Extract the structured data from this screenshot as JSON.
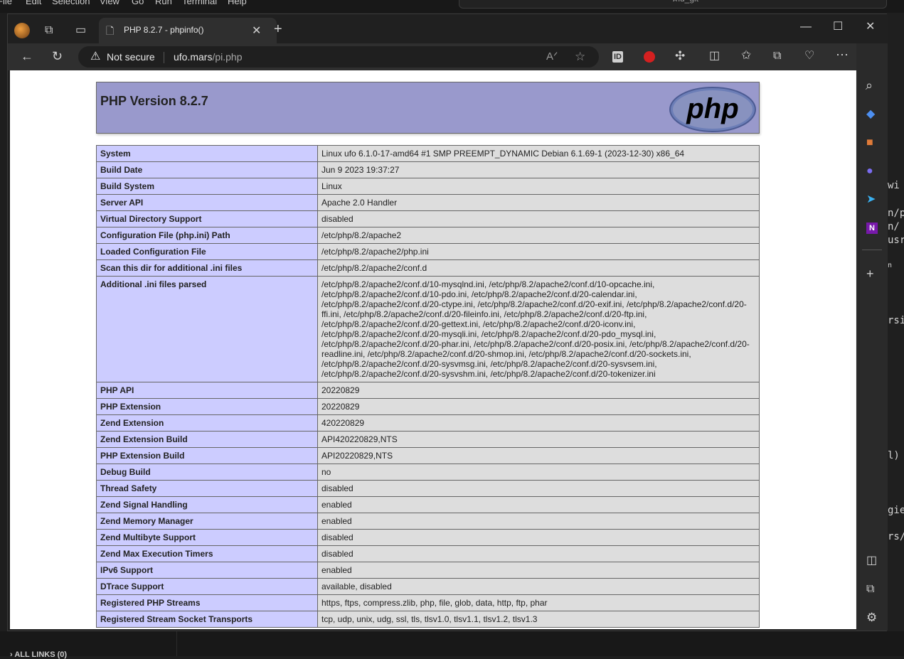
{
  "vscode": {
    "menu": [
      "File",
      "Edit",
      "Selection",
      "View",
      "Go",
      "Run",
      "Terminal",
      "Help"
    ],
    "search_text": "md_git",
    "code_fragments": [
      "wi",
      "n/p",
      "n/",
      "usr",
      "n",
      "rsi",
      "l)",
      "gie",
      "rs/"
    ],
    "sidebar_section": "ALL LINKS (0)"
  },
  "browser": {
    "tab_title": "PHP 8.2.7 - phpinfo()",
    "security_label": "Not secure",
    "url_host": "ufo.mars",
    "url_path": "/pi.php",
    "icons": {
      "profile": "profile-avatar-icon",
      "workspaces": "workspaces-icon",
      "tab_actions": "tab-actions-icon",
      "new_tab": "plus-icon",
      "back": "back-arrow-icon",
      "refresh": "refresh-icon",
      "read_aloud": "read-aloud-icon",
      "favorite": "star-icon",
      "extensions": "puzzle-icon",
      "split": "split-screen-icon",
      "favorites": "favorites-icon",
      "collections": "collections-icon",
      "performance": "heart-pulse-icon",
      "more": "more-icon",
      "copilot": "copilot-icon"
    }
  },
  "phpinfo": {
    "title": "PHP Version 8.2.7",
    "logo_text": "php",
    "rows": [
      {
        "k": "System",
        "v": "Linux ufo 6.1.0-17-amd64 #1 SMP PREEMPT_DYNAMIC Debian 6.1.69-1 (2023-12-30) x86_64"
      },
      {
        "k": "Build Date",
        "v": "Jun 9 2023 19:37:27"
      },
      {
        "k": "Build System",
        "v": "Linux"
      },
      {
        "k": "Server API",
        "v": "Apache 2.0 Handler"
      },
      {
        "k": "Virtual Directory Support",
        "v": "disabled"
      },
      {
        "k": "Configuration File (php.ini) Path",
        "v": "/etc/php/8.2/apache2"
      },
      {
        "k": "Loaded Configuration File",
        "v": "/etc/php/8.2/apache2/php.ini"
      },
      {
        "k": "Scan this dir for additional .ini files",
        "v": "/etc/php/8.2/apache2/conf.d"
      },
      {
        "k": "Additional .ini files parsed",
        "v": "/etc/php/8.2/apache2/conf.d/10-mysqlnd.ini, /etc/php/8.2/apache2/conf.d/10-opcache.ini, /etc/php/8.2/apache2/conf.d/10-pdo.ini, /etc/php/8.2/apache2/conf.d/20-calendar.ini, /etc/php/8.2/apache2/conf.d/20-ctype.ini, /etc/php/8.2/apache2/conf.d/20-exif.ini, /etc/php/8.2/apache2/conf.d/20-ffi.ini, /etc/php/8.2/apache2/conf.d/20-fileinfo.ini, /etc/php/8.2/apache2/conf.d/20-ftp.ini, /etc/php/8.2/apache2/conf.d/20-gettext.ini, /etc/php/8.2/apache2/conf.d/20-iconv.ini, /etc/php/8.2/apache2/conf.d/20-mysqli.ini, /etc/php/8.2/apache2/conf.d/20-pdo_mysql.ini, /etc/php/8.2/apache2/conf.d/20-phar.ini, /etc/php/8.2/apache2/conf.d/20-posix.ini, /etc/php/8.2/apache2/conf.d/20-readline.ini, /etc/php/8.2/apache2/conf.d/20-shmop.ini, /etc/php/8.2/apache2/conf.d/20-sockets.ini, /etc/php/8.2/apache2/conf.d/20-sysvmsg.ini, /etc/php/8.2/apache2/conf.d/20-sysvsem.ini, /etc/php/8.2/apache2/conf.d/20-sysvshm.ini, /etc/php/8.2/apache2/conf.d/20-tokenizer.ini"
      },
      {
        "k": "PHP API",
        "v": "20220829"
      },
      {
        "k": "PHP Extension",
        "v": "20220829"
      },
      {
        "k": "Zend Extension",
        "v": "420220829"
      },
      {
        "k": "Zend Extension Build",
        "v": "API420220829,NTS"
      },
      {
        "k": "PHP Extension Build",
        "v": "API20220829,NTS"
      },
      {
        "k": "Debug Build",
        "v": "no"
      },
      {
        "k": "Thread Safety",
        "v": "disabled"
      },
      {
        "k": "Zend Signal Handling",
        "v": "enabled"
      },
      {
        "k": "Zend Memory Manager",
        "v": "enabled"
      },
      {
        "k": "Zend Multibyte Support",
        "v": "disabled"
      },
      {
        "k": "Zend Max Execution Timers",
        "v": "disabled"
      },
      {
        "k": "IPv6 Support",
        "v": "enabled"
      },
      {
        "k": "DTrace Support",
        "v": "available, disabled"
      },
      {
        "k": "Registered PHP Streams",
        "v": "https, ftps, compress.zlib, php, file, glob, data, http, ftp, phar"
      },
      {
        "k": "Registered Stream Socket Transports",
        "v": "tcp, udp, unix, udg, ssl, tls, tlsv1.0, tlsv1.1, tlsv1.2, tlsv1.3"
      }
    ]
  },
  "colors": {
    "header_bg": "#9999cc",
    "key_bg": "#ccccff",
    "value_bg": "#dddddd"
  }
}
